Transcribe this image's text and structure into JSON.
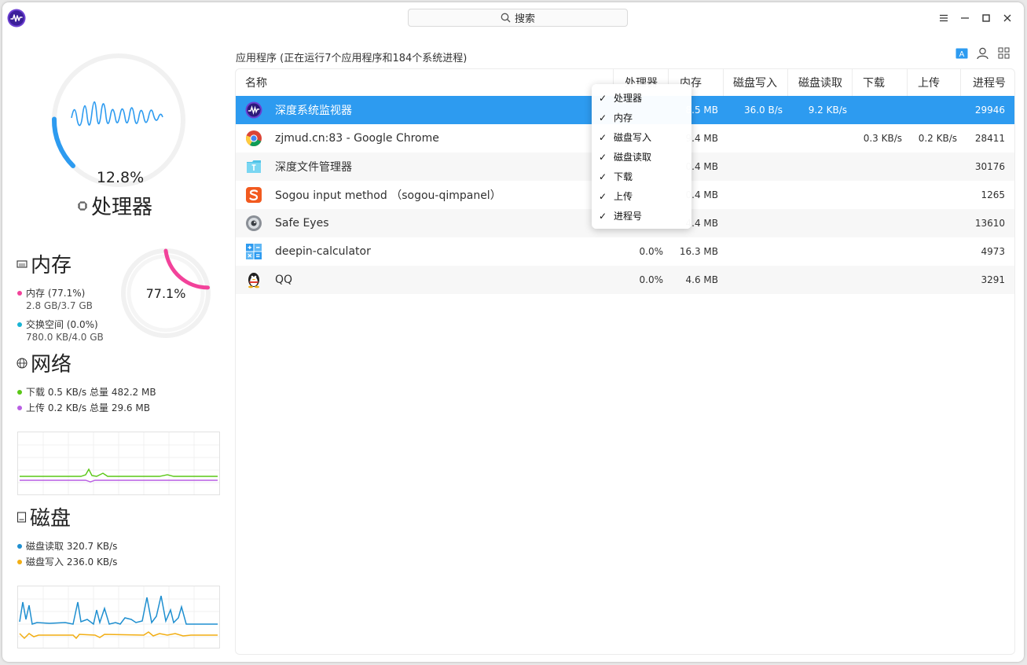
{
  "window": {
    "search_label": "搜索"
  },
  "cpu": {
    "percent": "12.8%",
    "title": "处理器",
    "usage": 0.128
  },
  "memory": {
    "title": "内存",
    "percent": "77.1%",
    "usage": 0.771,
    "mem_label": "内存 (77.1%)",
    "mem_value": "2.8 GB/3.7 GB",
    "swap_label": "交换空间 (0.0%)",
    "swap_value": "780.0 KB/4.0 GB",
    "colors": {
      "mem": "#f2429a",
      "swap": "#19b4d4"
    }
  },
  "network": {
    "title": "网络",
    "download": "下载 0.5 KB/s",
    "download_total": "总量 482.2 MB",
    "upload": "上传 0.2 KB/s",
    "upload_total": "总量 29.6 MB",
    "colors": {
      "download": "#5ac716",
      "upload": "#b95ee3"
    }
  },
  "disk": {
    "title": "磁盘",
    "read": "磁盘读取 320.7 KB/s",
    "write": "磁盘写入 236.0 KB/s",
    "colors": {
      "read": "#1f8fd0",
      "write": "#f2ae14"
    }
  },
  "processes": {
    "summary": "应用程序 (正在运行7个应用程序和184个系统进程)",
    "headers": {
      "name": "名称",
      "cpu": "处理器",
      "mem": "内存",
      "disk_write": "磁盘写入",
      "disk_read": "磁盘读取",
      "download": "下载",
      "upload": "上传",
      "pid": "进程号"
    },
    "rows": [
      {
        "name": "深度系统监视器",
        "icon": "deepin-system-monitor-icon",
        "cpu": "",
        "mem": "8.5 MB",
        "disk_write": "36.0 B/s",
        "disk_read": "9.2 KB/s",
        "download": "",
        "upload": "",
        "pid": "29946"
      },
      {
        "name": "zjmud.cn:83 - Google Chrome",
        "icon": "google-chrome-icon",
        "cpu": "",
        "mem": "9.4 MB",
        "disk_write": "",
        "disk_read": "",
        "download": "0.3 KB/s",
        "upload": "0.2 KB/s",
        "pid": "28411"
      },
      {
        "name": "深度文件管理器",
        "icon": "file-manager-icon",
        "cpu": "",
        "mem": "0.4 MB",
        "disk_write": "",
        "disk_read": "",
        "download": "",
        "upload": "",
        "pid": "30176"
      },
      {
        "name": "Sogou input method （sogou-qimpanel）",
        "icon": "sogou-icon",
        "cpu": "",
        "mem": "0.4 MB",
        "disk_write": "",
        "disk_read": "",
        "download": "",
        "upload": "",
        "pid": "1265"
      },
      {
        "name": "Safe Eyes",
        "icon": "safe-eyes-icon",
        "cpu": "",
        "mem": "4.4 MB",
        "disk_write": "",
        "disk_read": "",
        "download": "",
        "upload": "",
        "pid": "13610"
      },
      {
        "name": "deepin-calculator",
        "icon": "calculator-icon",
        "cpu": "0.0%",
        "mem": "16.3 MB",
        "disk_write": "",
        "disk_read": "",
        "download": "",
        "upload": "",
        "pid": "4973"
      },
      {
        "name": "QQ",
        "icon": "qq-penguin-icon",
        "cpu": "0.0%",
        "mem": "4.6 MB",
        "disk_write": "",
        "disk_read": "",
        "download": "",
        "upload": "",
        "pid": "3291"
      }
    ]
  },
  "column_menu": {
    "items": [
      {
        "label": "处理器",
        "checked": true
      },
      {
        "label": "内存",
        "checked": true
      },
      {
        "label": "磁盘写入",
        "checked": true
      },
      {
        "label": "磁盘读取",
        "checked": true
      },
      {
        "label": "下载",
        "checked": true
      },
      {
        "label": "上传",
        "checked": true
      },
      {
        "label": "进程号",
        "checked": true
      }
    ],
    "check_glyph": "✓"
  },
  "accent": "#2d9bf0"
}
